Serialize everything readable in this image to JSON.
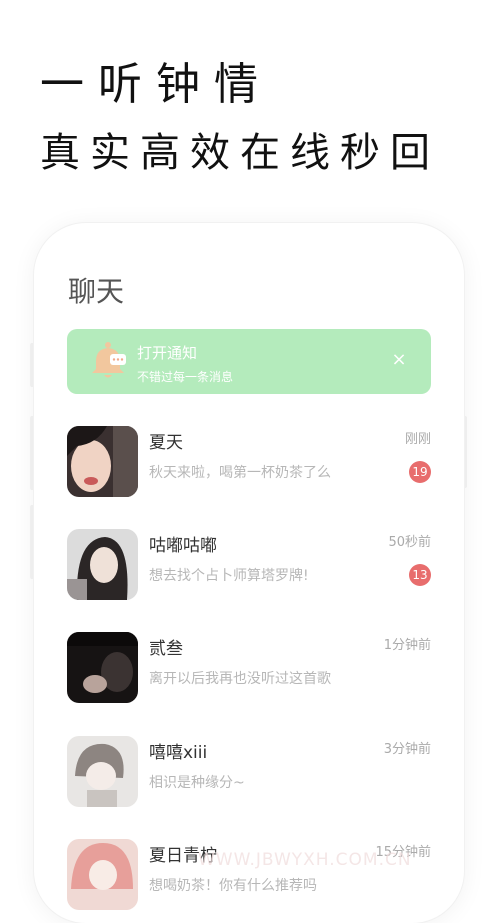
{
  "hero": {
    "line1": "一听钟情",
    "line2": "真实高效在线秒回"
  },
  "screen": {
    "title": "聊天",
    "notification": {
      "title": "打开通知",
      "subtitle": "不错过每一条消息",
      "close": "×",
      "icon": "bell-icon"
    },
    "chats": [
      {
        "name": "夏天",
        "message": "秋天来啦，喝第一杯奶茶了么",
        "time": "刚刚",
        "unread": "19"
      },
      {
        "name": "咕嘟咕嘟",
        "message": "想去找个占卜师算塔罗牌!",
        "time": "50秒前",
        "unread": "13"
      },
      {
        "name": "贰叁",
        "message": "离开以后我再也没听过这首歌",
        "time": "1分钟前",
        "unread": ""
      },
      {
        "name": "嘻嘻xiii",
        "message": "相识是种缘分~",
        "time": "3分钟前",
        "unread": ""
      },
      {
        "name": "夏日青柠",
        "message": "想喝奶茶！你有什么推荐吗",
        "time": "15分钟前",
        "unread": ""
      }
    ]
  },
  "watermark": "WWW.JBWYXH.COM.CN",
  "colors": {
    "accent": "#b4ebbc",
    "badge": "#e86d6d"
  }
}
